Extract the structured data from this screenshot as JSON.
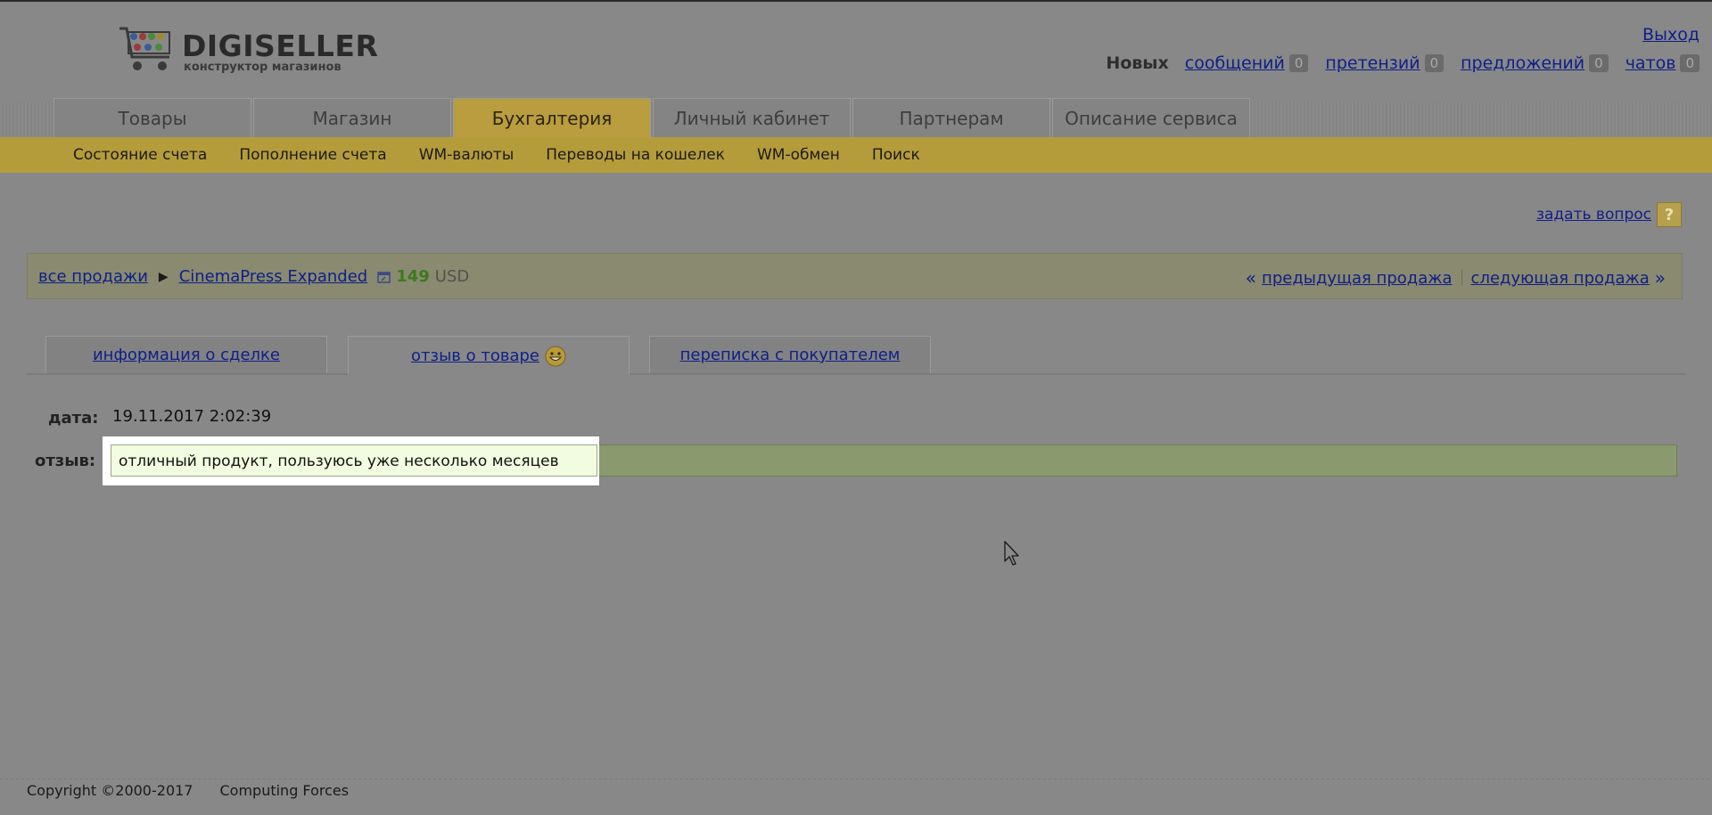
{
  "header": {
    "logo_name": "DIGISELLER",
    "logo_sub": "конструктор магазинов",
    "logout": "Выход",
    "new_label": "Новых",
    "counters": [
      {
        "label": "сообщений",
        "count": "0"
      },
      {
        "label": "претензий",
        "count": "0"
      },
      {
        "label": "предложений",
        "count": "0"
      },
      {
        "label": "чатов",
        "count": "0"
      }
    ]
  },
  "main_tabs": [
    {
      "label": "Товары",
      "active": false
    },
    {
      "label": "Магазин",
      "active": false
    },
    {
      "label": "Бухгалтерия",
      "active": true
    },
    {
      "label": "Личный кабинет",
      "active": false
    },
    {
      "label": "Партнерам",
      "active": false
    },
    {
      "label": "Описание сервиса",
      "active": false
    }
  ],
  "sub_menu": [
    "Состояние счета",
    "Пополнение счета",
    "WM-валюты",
    "Переводы на кошелек",
    "WM-обмен",
    "Поиск"
  ],
  "ask_question": "задать вопрос",
  "ask_icon": "help-question-icon",
  "breadcrumb": {
    "all_sales": "все продажи",
    "product": "CinemaPress Expanded",
    "price": "149",
    "currency": "USD",
    "prev": "предыдущая продажа",
    "next": "следующая продажа"
  },
  "sale_tabs": [
    {
      "label": "информация о сделке",
      "active": false
    },
    {
      "label": "отзыв о товаре",
      "active": true,
      "icon": "smile-icon"
    },
    {
      "label": "переписка с покупателем",
      "active": false
    }
  ],
  "review": {
    "date_label": "дата:",
    "date_value": "19.11.2017 2:02:39",
    "review_label": "отзыв:",
    "review_text": "отличный продукт, пользуюсь уже несколько месяцев"
  },
  "footer": {
    "copyright": "Copyright ©2000-2017",
    "company": "Computing Forces"
  },
  "colors": {
    "accent": "#b99d3e",
    "link": "#0f1f88",
    "price": "#3e7a1e",
    "overlay_bg": "#888888",
    "highlight": "#f2fce0"
  }
}
